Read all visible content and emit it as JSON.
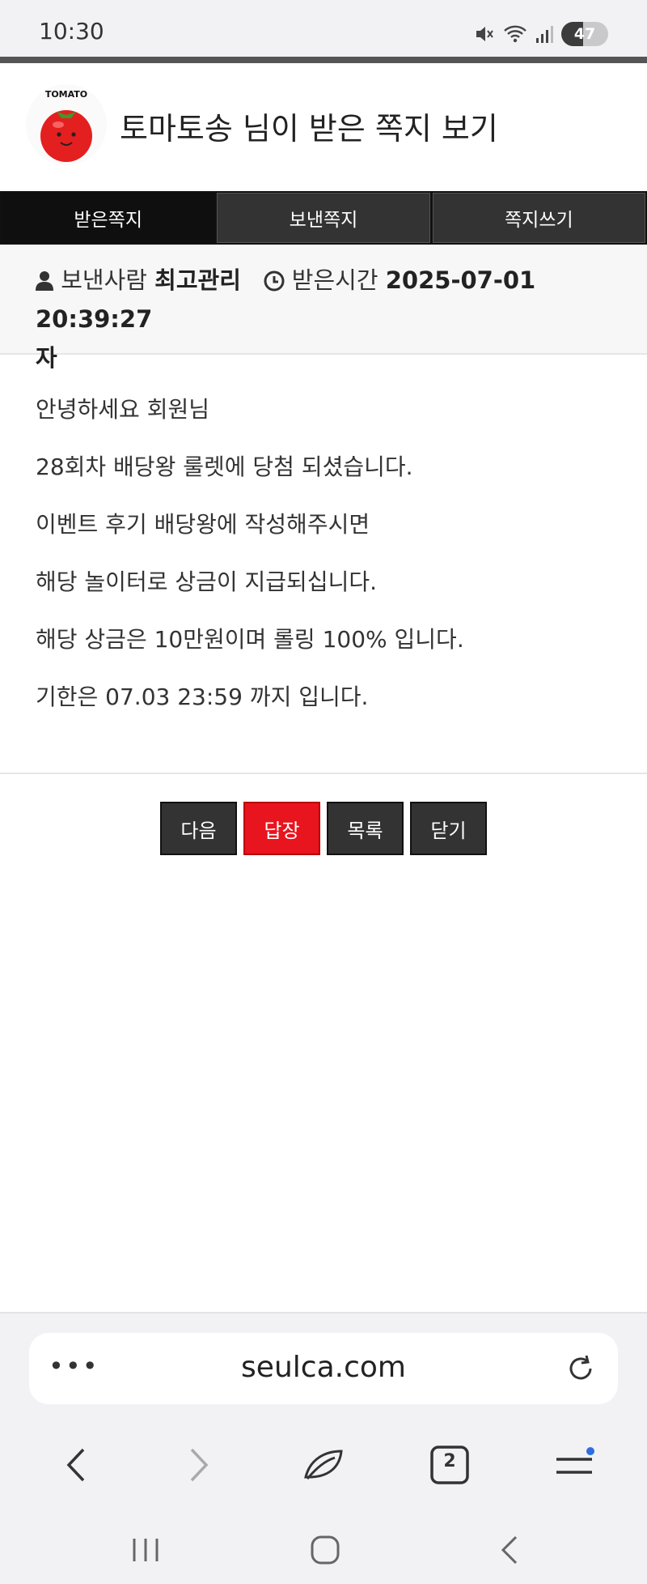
{
  "status": {
    "time": "10:30",
    "battery": "47",
    "battery_level": 0.47
  },
  "header": {
    "logo_text": "TOMATO",
    "title": "토마토송 님이 받은 쪽지 보기"
  },
  "tabs": [
    {
      "label": "받은쪽지",
      "active": true
    },
    {
      "label": "보낸쪽지",
      "active": false
    },
    {
      "label": "쪽지쓰기",
      "active": false
    }
  ],
  "meta": {
    "sender_label": "보낸사람",
    "sender": "최고관리",
    "received_label": "받은시간",
    "received_time": "2025-07-01 20:39:27",
    "wrap_char": "자"
  },
  "message": {
    "lines": [
      "안녕하세요 회원님",
      "28회차 배당왕 룰렛에 당첨 되셨습니다.",
      "이벤트 후기 배당왕에 작성해주시면",
      "해당 놀이터로 상금이 지급되십니다.",
      "해당 상금은 10만원이며 롤링 100% 입니다.",
      "기한은 07.03 23:59 까지 입니다."
    ]
  },
  "buttons": {
    "next": "다음",
    "reply": "답장",
    "list": "목록",
    "close": "닫기"
  },
  "browser": {
    "url": "seulca.com",
    "tab_count": "2"
  },
  "colors": {
    "accent_red": "#e8141e",
    "tab_bg": "#333333",
    "tab_active_bg": "#0f0f0f"
  }
}
